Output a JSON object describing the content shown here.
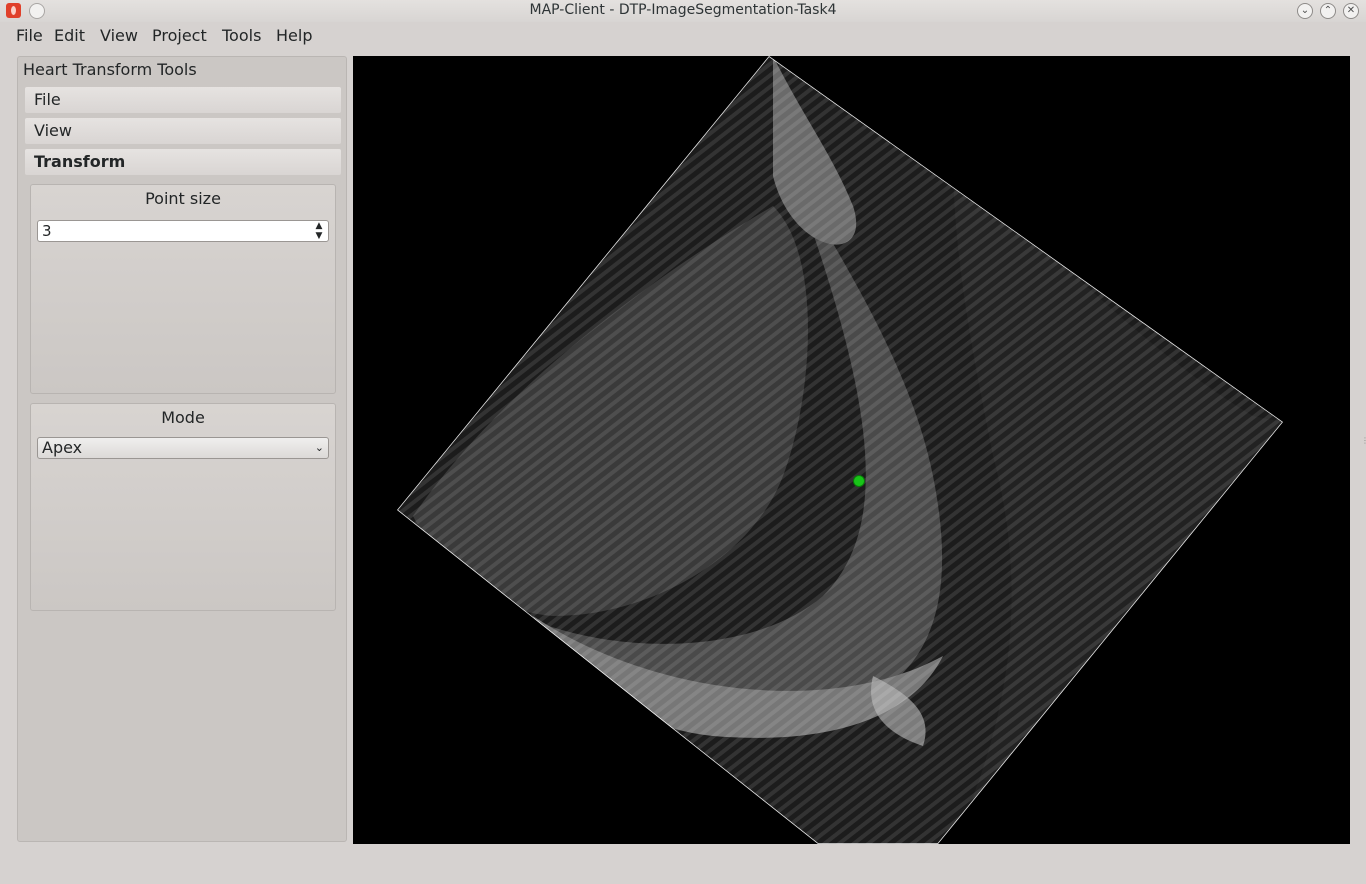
{
  "window": {
    "title": "MAP-Client - DTP-ImageSegmentation-Task4",
    "icons": [
      "app-icon",
      "window-menu-icon",
      "minimize-icon",
      "maximize-icon",
      "close-icon"
    ]
  },
  "menubar": {
    "items": [
      "File",
      "Edit",
      "View",
      "Project",
      "Tools",
      "Help"
    ]
  },
  "panel": {
    "title": "Heart Transform Tools",
    "tabs": [
      {
        "label": "File",
        "active": false
      },
      {
        "label": "View",
        "active": false
      },
      {
        "label": "Transform",
        "active": true
      }
    ],
    "point_size": {
      "label": "Point size",
      "value": "3"
    },
    "mode": {
      "label": "Mode",
      "selected": "Apex"
    }
  },
  "viewer": {
    "content": "MRI image slice",
    "marker_color": "#18c418"
  }
}
